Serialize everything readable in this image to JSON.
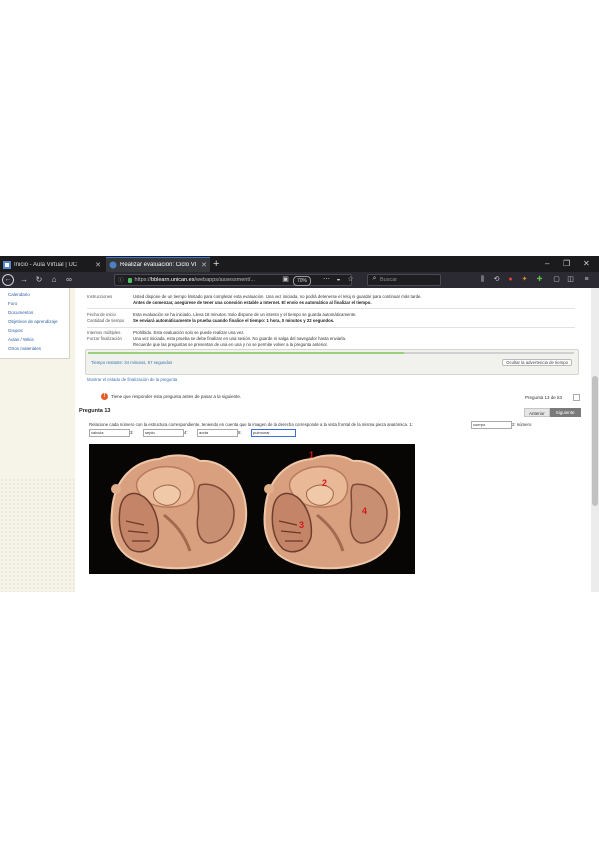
{
  "browser": {
    "tabs": [
      {
        "title": "Inicio - Aula Virtual | UC",
        "active": false
      },
      {
        "title": "Realizar evaluación: Ciclo VI - 2",
        "active": true
      }
    ],
    "url_prefix": "https://",
    "url_host": "bblearn.unican.es",
    "url_path": "/webapps/assessment/...",
    "zoom": "70%",
    "search_placeholder": "Buscar",
    "window_controls": [
      "–",
      "❐",
      "✕"
    ],
    "accent": "#3b78d6"
  },
  "sidebar": {
    "items": [
      "Calendario",
      "Foro",
      "Documentos",
      "Objetivos de aprendizaje",
      "Grupos",
      "Aulas / Wikis",
      "Otros materiales"
    ]
  },
  "summary": {
    "rows": [
      {
        "key": "Instrucciones",
        "value": "Usted dispone de un tiempo limitado para completar esta evaluación. Una vez iniciada, no podrá detenerse el reloj ni guardar para continuar más tarde.",
        "bold": false
      },
      {
        "key": "",
        "value": "Antes de comenzar, asegúrese de tener una conexión estable a Internet. El envío es automático al finalizar el tiempo.",
        "bold": true
      },
      {
        "key": "Fecha de inicio",
        "value": "Esta evaluación se ha iniciado. Lleva 18 minutos. Solo dispone de un intento y el tiempo se guarda automáticamente.",
        "bold": false
      },
      {
        "key": "Cantidad de tiempo",
        "value": "Se enviará automáticamente la prueba cuando finalice el tiempo: 1 hora, 0 minutos y 22 segundos.",
        "bold": true
      },
      {
        "key": "Intentos múltiples",
        "value": "Prohibido. Esta evaluación solo se puede realizar una vez.",
        "bold": false
      },
      {
        "key": "Forzar finalización",
        "value": "Una vez iniciada, esta prueba se debe finalizar en una sesión. No guarde ni salga del navegador hasta enviarla.",
        "bold": false
      },
      {
        "key": "",
        "value": "Recuerde que las preguntas se presentan de una en una y no se permite volver a la pregunta anterior.",
        "bold": false
      }
    ]
  },
  "timer": {
    "progress": 0.65,
    "text": "Tiempo restante: 34 minutos, 57 segundos",
    "toggle_label": "Ocultar la advertencia de tiempo",
    "show_link": "Mostrar el estado de finalización de la pregunta"
  },
  "notice": {
    "text": "Tiene que responder esta pregunta antes de pasar a la siguiente.",
    "page_counter": "Pregunta 13 de 53"
  },
  "question": {
    "heading": "Pregunta 13",
    "prev_label": "Anterior",
    "next_label": "Siguiente",
    "text": "Relacione cada número con la estructura correspondiente, teniendo en cuenta que la imagen de la derecha corresponde a la vista frontal de la misma pieza anatómica. 1:",
    "tail": "2: número",
    "answers": [
      {
        "value": "valvula",
        "label": "3:"
      },
      {
        "value": "septo",
        "label": "4:"
      },
      {
        "value": "aorta",
        "label": "5:"
      },
      {
        "value": "pulmonar",
        "label": ""
      }
    ],
    "first_answer": "cuerpo",
    "figure_labels": [
      "1",
      "2",
      "3",
      "4"
    ]
  }
}
